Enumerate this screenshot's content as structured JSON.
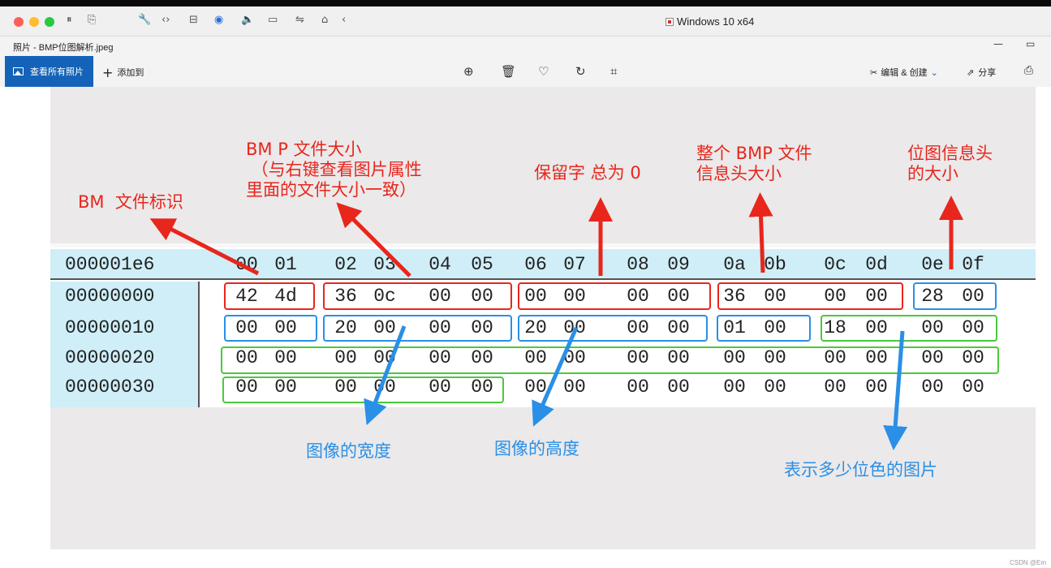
{
  "vm_toolbar": {
    "title": "Windows 10 x64",
    "traffic_colors": [
      "#fe5f57",
      "#febc2e",
      "#28c840"
    ]
  },
  "app": {
    "title": "照片 - BMP位图解析.jpeg",
    "minimize": "—",
    "restore": "▭"
  },
  "cmdbar": {
    "view_all": "查看所有照片",
    "add_to": "添加到",
    "edit_create": "编辑 & 创建",
    "share": "分享"
  },
  "annotations": {
    "bm_id": "BM  文件标识",
    "file_size": "BM P 文件大小\n （与右键查看图片属性\n里面的文件大小一致）",
    "reserved": "保留字 总为 0",
    "header_size": "整个 BMP 文件\n信息头大小",
    "info_header": "位图信息头\n的大小",
    "width": "图像的宽度",
    "height": "图像的高度",
    "colors": "表示多少位色的图片"
  },
  "hex": {
    "header_addr": "000001e6",
    "header_cols": [
      "00",
      "01",
      "02",
      "03",
      "04",
      "05",
      "06",
      "07",
      "08",
      "09",
      "0a",
      "0b",
      "0c",
      "0d",
      "0e",
      "0f"
    ],
    "rows": [
      {
        "addr": "00000000",
        "bytes": [
          "42",
          "4d",
          "36",
          "0c",
          "00",
          "00",
          "00",
          "00",
          "00",
          "00",
          "36",
          "00",
          "00",
          "00",
          "28",
          "00"
        ]
      },
      {
        "addr": "00000010",
        "bytes": [
          "00",
          "00",
          "20",
          "00",
          "00",
          "00",
          "20",
          "00",
          "00",
          "00",
          "01",
          "00",
          "18",
          "00",
          "00",
          "00"
        ]
      },
      {
        "addr": "00000020",
        "bytes": [
          "00",
          "00",
          "00",
          "00",
          "00",
          "00",
          "00",
          "00",
          "00",
          "00",
          "00",
          "00",
          "00",
          "00",
          "00",
          "00"
        ]
      },
      {
        "addr": "00000030",
        "bytes": [
          "00",
          "00",
          "00",
          "00",
          "00",
          "00",
          "00",
          "00",
          "00",
          "00",
          "00",
          "00",
          "00",
          "00",
          "00",
          "00"
        ]
      }
    ]
  },
  "watermark": "CSDN @Em"
}
